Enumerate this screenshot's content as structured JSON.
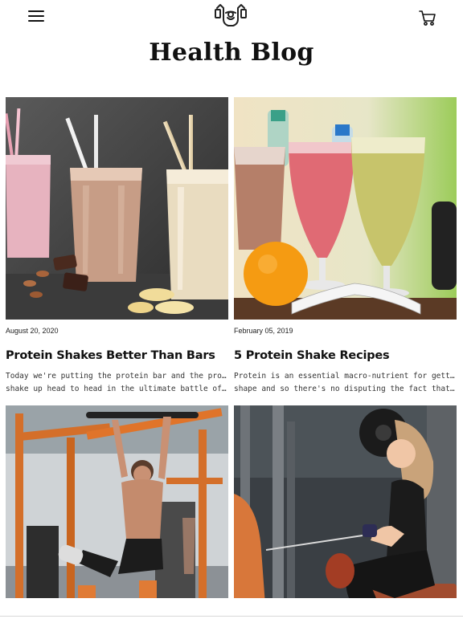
{
  "header": {
    "menu_icon": "hamburger-menu-icon",
    "logo_icon": "muscle-arms-logo-icon",
    "cart_icon": "shopping-cart-icon"
  },
  "page": {
    "title": "Health Blog"
  },
  "posts": [
    {
      "date": "August 20, 2020",
      "title": "Protein Shakes Better Than Bars",
      "excerpt_line1": "Today we're putting the protein bar and the protein",
      "excerpt_line2": "shake up head to head in the ultimate battle of th..."
    },
    {
      "date": "February 05, 2019",
      "title": "5 Protein Shake Recipes",
      "excerpt_line1": "Protein is an essential macro-nutrient for getting in",
      "excerpt_line2": "shape and so there's no disputing the fact that pr..."
    },
    {
      "date": "",
      "title": "",
      "excerpt_line1": "",
      "excerpt_line2": ""
    },
    {
      "date": "",
      "title": "",
      "excerpt_line1": "",
      "excerpt_line2": ""
    }
  ],
  "colors": {
    "accent": "#e0742a",
    "text": "#111111"
  }
}
